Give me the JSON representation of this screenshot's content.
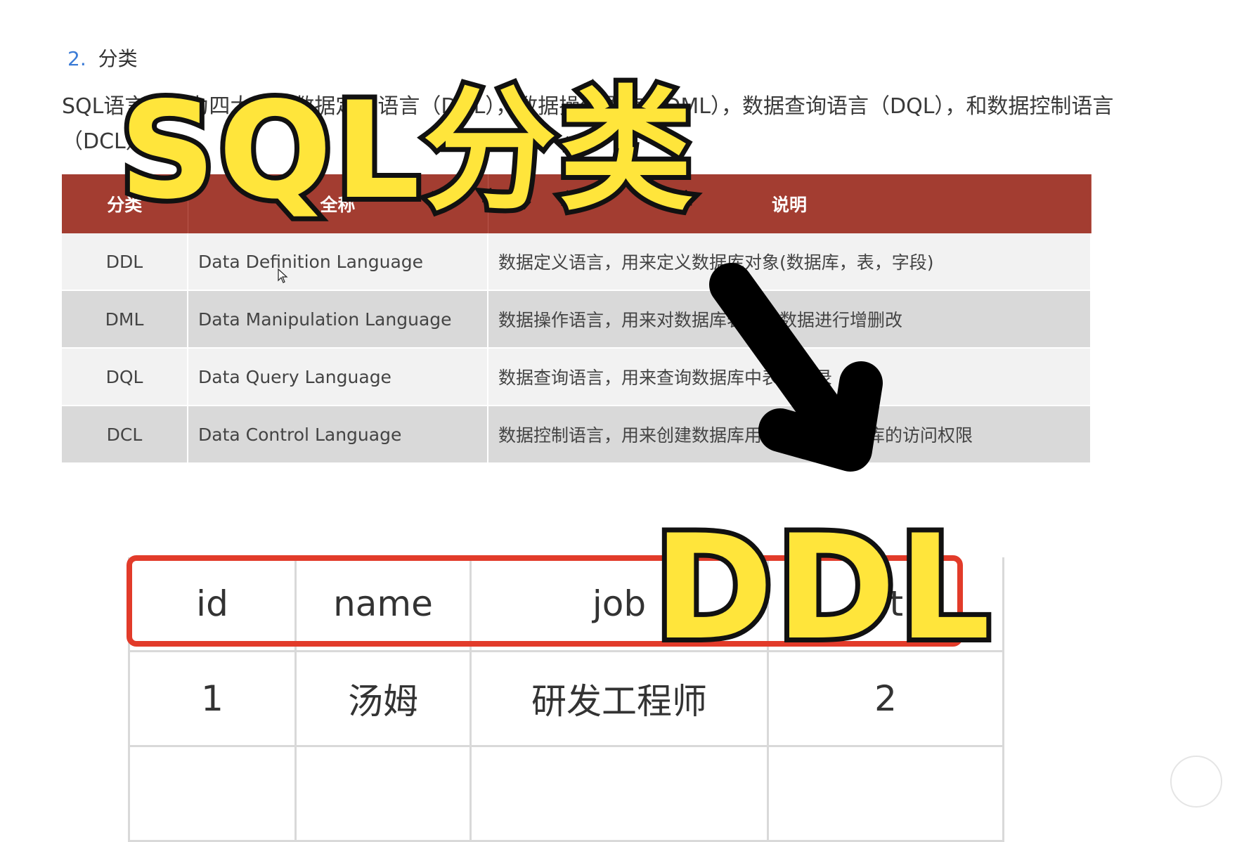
{
  "section": {
    "number": "2.",
    "title": "分类"
  },
  "paragraph": "SQL语言共分为四大类：数据定义语言（DDL），数据操作语言（DML），数据查询语言（DQL），和数据控制语言（DCL）。",
  "classification_table": {
    "headers": [
      "分类",
      "全称",
      "说明"
    ],
    "rows": [
      {
        "abbr": "DDL",
        "full": "Data Definition Language",
        "desc": "数据定义语言，用来定义数据库对象(数据库，表，字段)"
      },
      {
        "abbr": "DML",
        "full": "Data Manipulation Language",
        "desc": "数据操作语言，用来对数据库表中的数据进行增删改"
      },
      {
        "abbr": "DQL",
        "full": "Data Query Language",
        "desc": "数据查询语言，用来查询数据库中表的记录"
      },
      {
        "abbr": "DCL",
        "full": "Data Control Language",
        "desc": "数据控制语言，用来创建数据库用户、控制数据库的访问权限"
      }
    ]
  },
  "employee_table": {
    "headers": [
      "id",
      "name",
      "job",
      "ot"
    ],
    "rows": [
      [
        "1",
        "汤姆",
        "研发工程师",
        "2"
      ]
    ]
  },
  "overlay": {
    "title": "SQL分类",
    "ddl": "DDL"
  },
  "colors": {
    "header_bg": "#a33d31",
    "highlight": "#e23b2a",
    "overlay_fill": "#ffe53b",
    "overlay_stroke": "#111111"
  }
}
